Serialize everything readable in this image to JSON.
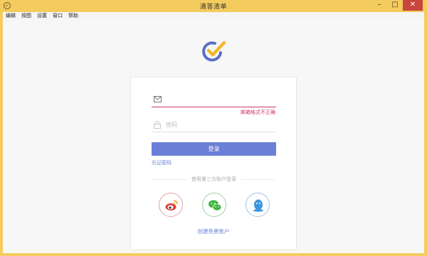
{
  "window": {
    "title": "滴答清单"
  },
  "menubar": {
    "items": [
      "编辑",
      "视图",
      "设置",
      "窗口",
      "帮助"
    ]
  },
  "login": {
    "email_placeholder": "",
    "email_error": "邮箱格式不正确",
    "password_placeholder": "密码",
    "login_button": "登录",
    "forgot_password": "忘记密码",
    "third_party_label": "使用第三方账户登录",
    "create_account": "创建免费账户"
  },
  "colors": {
    "accent": "#6a7fd7",
    "error": "#c93a69",
    "window_frame": "#f5cc5e"
  }
}
